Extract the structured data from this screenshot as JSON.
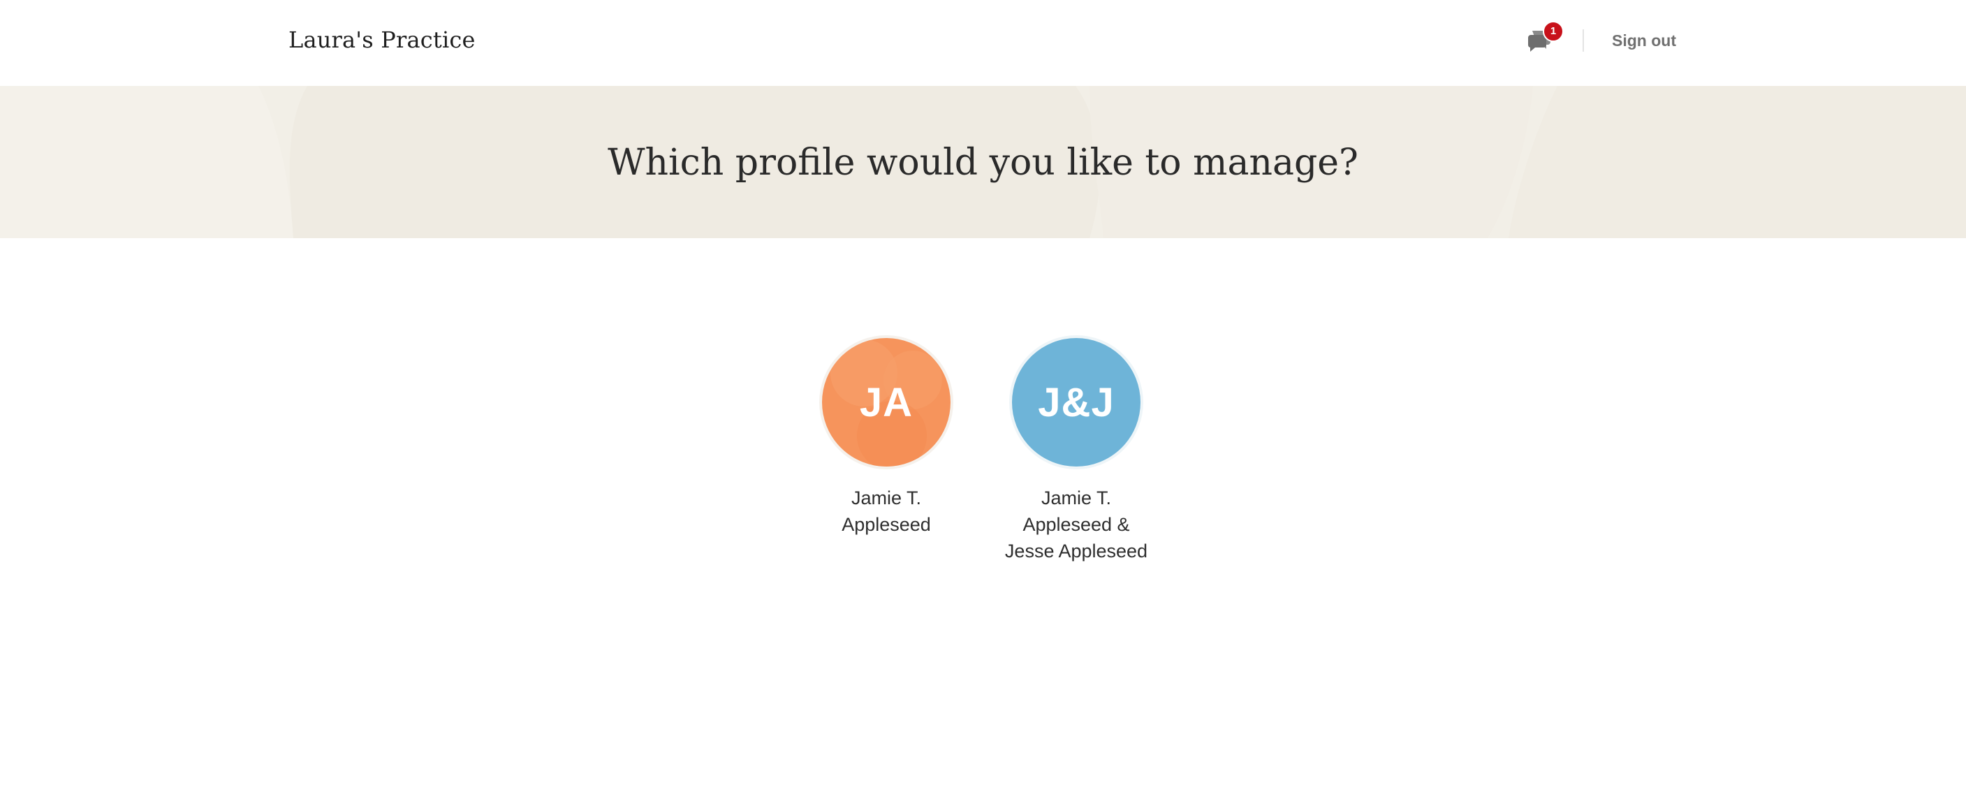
{
  "header": {
    "brand": "Laura's Practice",
    "messages_badge": "1",
    "sign_out": "Sign out"
  },
  "hero": {
    "title": "Which profile would you like to manage?"
  },
  "profiles": [
    {
      "initials": "JA",
      "name": "Jamie T. Appleseed",
      "color": "#f6945c"
    },
    {
      "initials": "J&J",
      "name": "Jamie T. Appleseed & Jesse Appleseed",
      "color": "#6eb4d8"
    }
  ],
  "colors": {
    "hero_background": "#f2efe7",
    "badge": "#c8111a"
  },
  "icons": {
    "messages": "chat-bubbles-icon"
  }
}
